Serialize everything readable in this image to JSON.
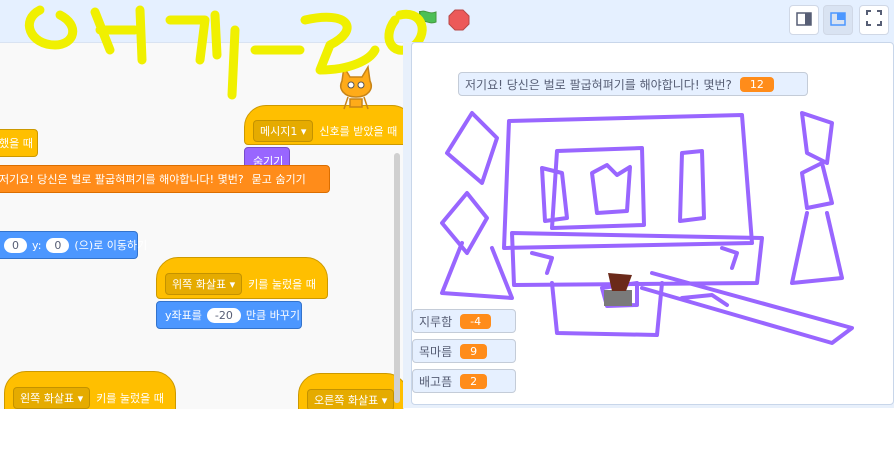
{
  "workspace": {
    "partial_event_suffix": "했을 때",
    "broadcast": {
      "message": "메시지1",
      "suffix": "신호를 받았을 때"
    },
    "hide_block": "숨기기",
    "ask_block": {
      "text": "저기요! 당신은 벌로 팔굽혀펴기를 해야합니다! 몇번?",
      "suffix": "묻고 숨기기"
    },
    "goto_block": {
      "x_value": "0",
      "y_label": "y:",
      "y_value": "0",
      "suffix": "(으)로 이동하기"
    },
    "key_up": {
      "key": "위쪽 화살표",
      "suffix": "키를 눌렀을 때"
    },
    "change_y": {
      "prefix": "y좌표를",
      "value": "-20",
      "suffix": "만큼 바꾸기"
    },
    "key_left": {
      "key": "왼쪽 화살표",
      "suffix": "키를 눌렀을 때"
    },
    "key_right": {
      "key": "오른쪽 화살표"
    }
  },
  "stage": {
    "question": "저기요! 당신은 벌로 팔굽혀펴기를 해야합니다! 몇번?",
    "question_value": "12",
    "monitors": [
      {
        "label": "지루함",
        "value": "-4"
      },
      {
        "label": "목마름",
        "value": "9"
      },
      {
        "label": "배고픔",
        "value": "2"
      }
    ]
  },
  "icons": [
    "green-flag-icon",
    "stop-icon",
    "small-stage-icon",
    "large-stage-icon",
    "fullscreen-icon",
    "sprite-cat-icon"
  ],
  "colors": {
    "event": "#ffbf00",
    "looks": "#9966ff",
    "motion": "#4c97ff",
    "variable": "#ff8c1a",
    "drawing": "#9966ff",
    "annotation": "#f0f000"
  }
}
